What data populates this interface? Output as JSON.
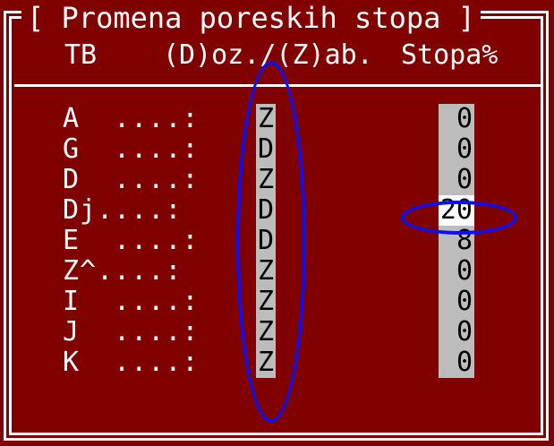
{
  "dialog": {
    "title": "[ Promena poreskih stopa ]"
  },
  "header": {
    "tb": "TB",
    "dz": "(D)oz./(Z)ab.",
    "stopa": "Stopa%"
  },
  "rows": [
    {
      "label": "A  ....:",
      "flag": "Z",
      "rate": "0"
    },
    {
      "label": "G  ....:",
      "flag": "D",
      "rate": "0"
    },
    {
      "label": "D  ....:",
      "flag": "Z",
      "rate": "0"
    },
    {
      "label": "Dj....:",
      "flag": "D",
      "rate": "20"
    },
    {
      "label": "E  ....:",
      "flag": "D",
      "rate": "8"
    },
    {
      "label": "Z^....:",
      "flag": "Z",
      "rate": "0"
    },
    {
      "label": "I  ....:",
      "flag": "Z",
      "rate": "0"
    },
    {
      "label": "J  ....:",
      "flag": "Z",
      "rate": "0"
    },
    {
      "label": "K  ....:",
      "flag": "Z",
      "rate": "0"
    }
  ],
  "colors": {
    "background": "#800000",
    "text": "#ffffff",
    "field": "#bcbcbc",
    "annotation": "#1010ee"
  }
}
